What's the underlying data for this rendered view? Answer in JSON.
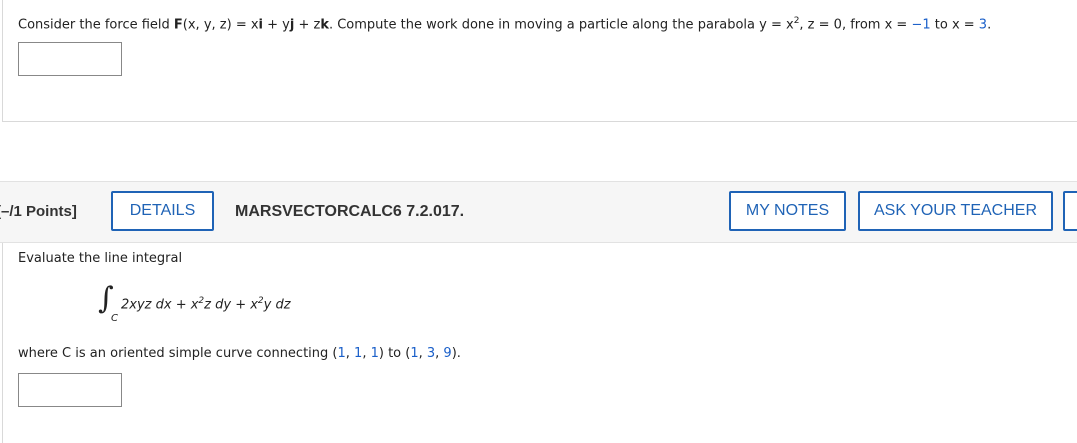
{
  "q1": {
    "prefix": "Consider the force field ",
    "field_bold": "F",
    "field_args": "(x, y, z) = x",
    "i": "i",
    "plus_y": " + y",
    "j": "j",
    "plus_z": " + z",
    "k": "k",
    "middle": ". Compute the work done in moving a particle along the parabola y = x",
    "exp": "2",
    "after_exp": ", z = 0, from x = ",
    "x_from": "−1",
    "to": " to x = ",
    "x_to": "3",
    "end": "."
  },
  "header": {
    "points": "[–/1 Points]",
    "details_label": "DETAILS",
    "course_code": "MARSVECTORCALC6 7.2.017.",
    "my_notes_label": "MY NOTES",
    "ask_teacher_label": "ASK YOUR TEACHER"
  },
  "q2": {
    "intro": "Evaluate the line integral",
    "integral_symbol": "∫",
    "path": "C",
    "integrand_a": "2xyz dx + x",
    "exp1": "2",
    "integrand_b": "z dy + x",
    "exp2": "2",
    "integrand_c": "y dz",
    "where_prefix": "where C is an oriented simple curve connecting (",
    "p1a": "1",
    "p1b": "1",
    "p1c": "1",
    "mid": ") to (",
    "p2a": "1",
    "p2b": "3",
    "p2c": "9",
    "where_end": ")."
  }
}
